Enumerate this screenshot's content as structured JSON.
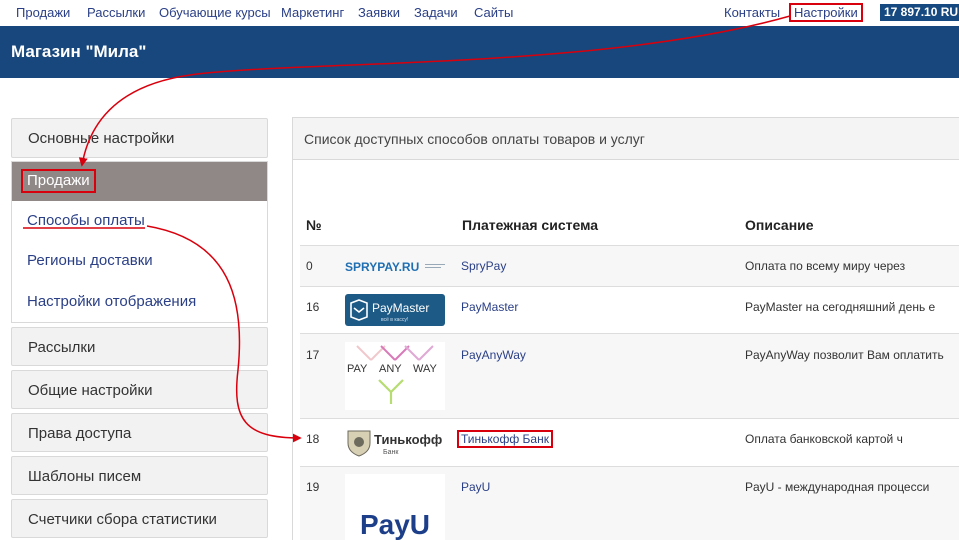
{
  "topnav": {
    "items": [
      "Продажи",
      "Рассылки",
      "Обучающие курсы",
      "Маркетинг",
      "Заявки",
      "Задачи",
      "Сайты"
    ],
    "contacts": "Контакты",
    "settings": "Настройки",
    "balance": "17 897.10 RU"
  },
  "header": {
    "title": "Магазин \"Мила\""
  },
  "sidebar": {
    "basic": "Основные настройки",
    "sales": "Продажи",
    "sub": [
      "Способы оплаты",
      "Регионы доставки",
      "Настройки отображения"
    ],
    "groups": [
      "Рассылки",
      "Общие настройки",
      "Права доступа",
      "Шаблоны писем",
      "Счетчики сбора статистики"
    ]
  },
  "main": {
    "title": "Список доступных способов оплаты товаров и услуг",
    "columns": {
      "num": "№",
      "system": "Платежная система",
      "desc": "Описание"
    },
    "rows": [
      {
        "num": "0",
        "name": "SpryPay",
        "desc": "Оплата по всему миру через",
        "logo": "sprypay-logo"
      },
      {
        "num": "16",
        "name": "PayMaster",
        "desc": "PayMaster на сегодняшний день е",
        "logo": "paymaster-logo"
      },
      {
        "num": "17",
        "name": "PayAnyWay",
        "desc": "PayAnyWay позволит Вам оплатить",
        "logo": "payanyway-logo"
      },
      {
        "num": "18",
        "name": "Тинькофф Банк",
        "desc": "Оплата банковской картой ч",
        "logo": "tinkoff-logo"
      },
      {
        "num": "19",
        "name": "PayU",
        "desc": "PayU - международная процесси",
        "logo": "payu-logo"
      }
    ]
  },
  "logos": {
    "sprypay_text": "SPRYPAY.RU",
    "paymaster_text": "PayMaster",
    "paymaster_sub": "всё в кассу!",
    "payanyway_words": [
      "PAY",
      "ANY",
      "WAY"
    ],
    "tinkoff_text": "Тинькофф",
    "tinkoff_sub": "Банк",
    "payu_text": "PayU"
  },
  "colors": {
    "accent": "#17477c",
    "highlight": "#d9000d",
    "link": "#2a3f86",
    "active_bg": "#908887"
  }
}
